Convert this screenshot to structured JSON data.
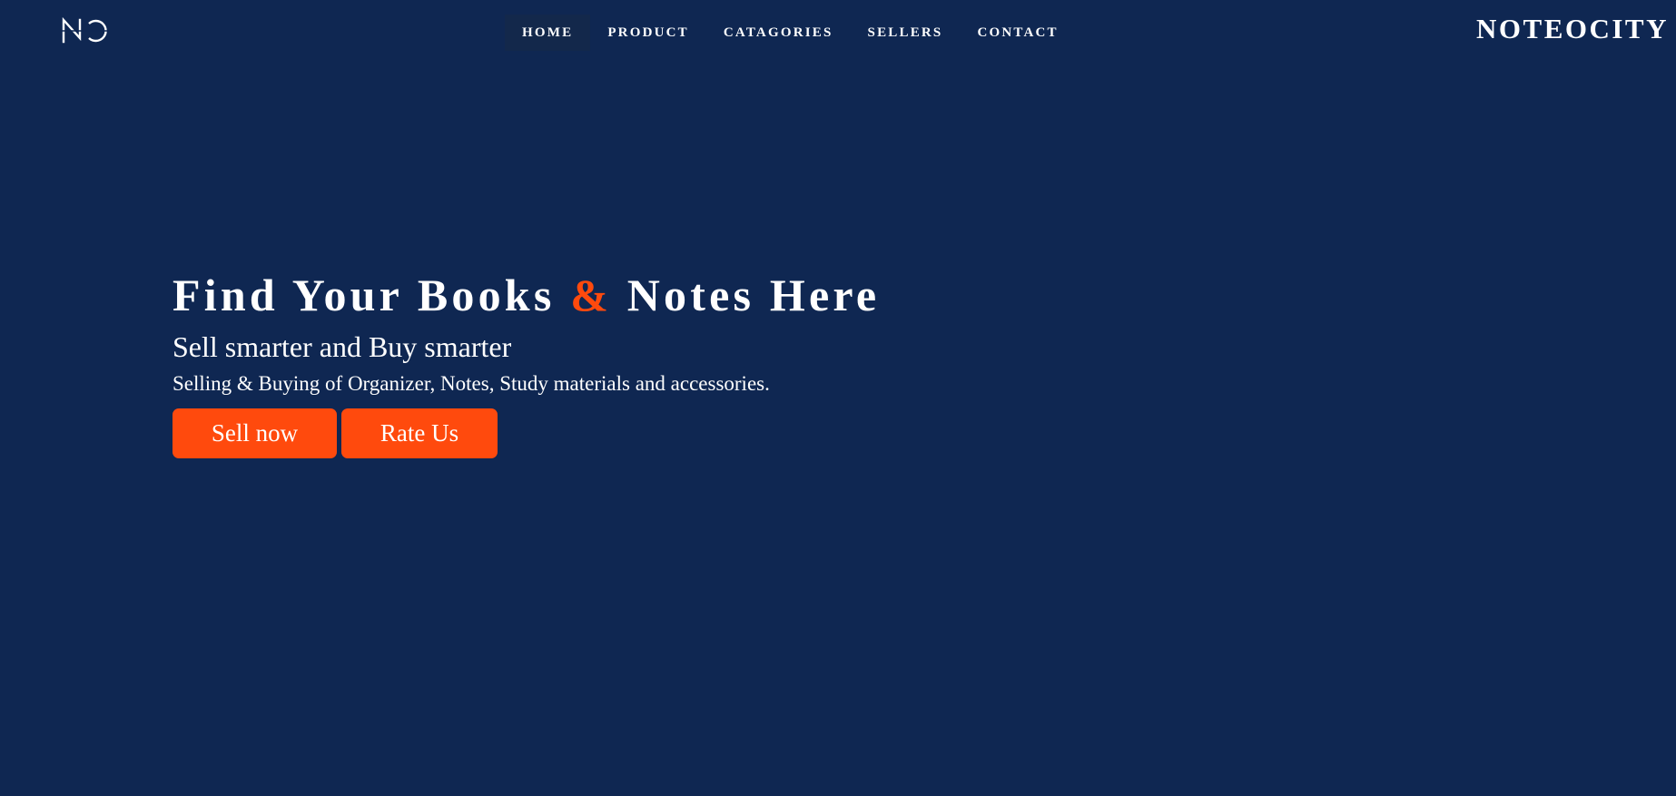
{
  "logo": {
    "text": "NO",
    "icon": "noteocity-monogram-icon"
  },
  "nav": {
    "items": [
      {
        "label": "HOME",
        "active": true
      },
      {
        "label": "PRODUCT",
        "active": false
      },
      {
        "label": "CATAGORIES",
        "active": false
      },
      {
        "label": "SELLERS",
        "active": false
      },
      {
        "label": "CONTACT",
        "active": false
      }
    ]
  },
  "brand": {
    "name": "NOTEOCITY"
  },
  "hero": {
    "title_part1": "Find Your Books",
    "title_amp": "&",
    "title_part2": "Notes Here",
    "subtitle": "Sell smarter and Buy smarter",
    "description": "Selling & Buying of Organizer, Notes, Study materials and accessories.",
    "sell_button": "Sell now",
    "rate_button": "Rate Us"
  },
  "colors": {
    "background": "#0f2752",
    "accent": "#ff4a0d",
    "nav_active": "#13284b",
    "text": "#ffffff"
  }
}
